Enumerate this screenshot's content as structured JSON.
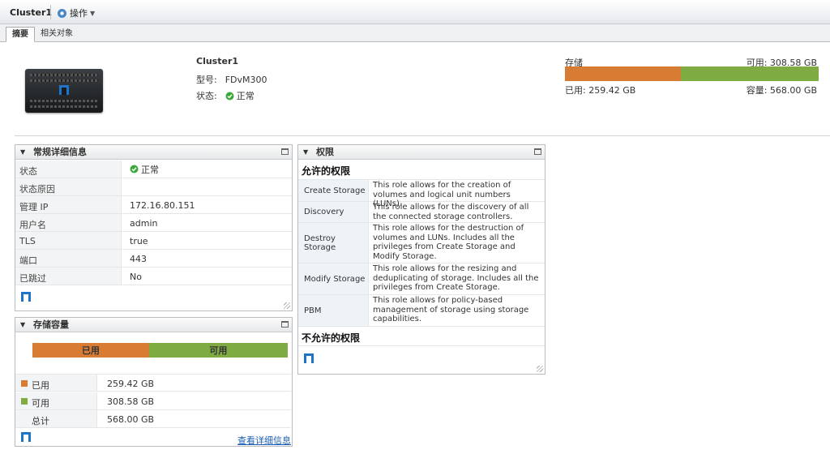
{
  "header": {
    "title": "Cluster1",
    "actions_label": "操作"
  },
  "tabs": [
    {
      "label": "摘要"
    },
    {
      "label": "相关对象"
    }
  ],
  "summary": {
    "name": "Cluster1",
    "model_label": "型号:",
    "model_value": "FDvM300",
    "status_label": "状态:",
    "status_value": "正常"
  },
  "storage": {
    "title": "存储",
    "free_text": "可用: 308.58 GB",
    "used_text": "已用: 259.42 GB",
    "capacity_text": "容量: 568.00 GB",
    "used_gb": 259.42,
    "free_gb": 308.58,
    "capacity_gb": 568.0,
    "used_color": "#d97c33",
    "free_color": "#7fac42"
  },
  "general": {
    "title": "常规详细信息",
    "rows": [
      {
        "key": "状态",
        "value": "正常"
      },
      {
        "key": "状态原因",
        "value": ""
      },
      {
        "key": "管理 IP",
        "value": "172.16.80.151"
      },
      {
        "key": "用户名",
        "value": "admin"
      },
      {
        "key": "TLS",
        "value": "true"
      },
      {
        "key": "端口",
        "value": "443"
      },
      {
        "key": "已跳过",
        "value": "No"
      }
    ]
  },
  "capacity": {
    "title": "存储容量",
    "bar_used_label": "已用",
    "bar_free_label": "可用",
    "rows": [
      {
        "key": "已用",
        "value": "259.42 GB"
      },
      {
        "key": "可用",
        "value": "308.58 GB"
      },
      {
        "key": "总计",
        "value": "568.00 GB"
      }
    ],
    "details_link": "查看详细信息"
  },
  "permissions": {
    "title": "权限",
    "allowed_heading": "允许的权限",
    "denied_heading": "不允许的权限",
    "items": [
      {
        "name": "Create Storage",
        "desc": "This role allows for the creation of volumes and logical unit numbers (LUNs)."
      },
      {
        "name": "Discovery",
        "desc": "This role allows for the discovery of all the connected storage controllers."
      },
      {
        "name": "Destroy Storage",
        "desc": "This role allows for the destruction of volumes and LUNs. Includes all the privileges from Create Storage and Modify Storage."
      },
      {
        "name": "Modify Storage",
        "desc": "This role allows for the resizing and deduplicating of storage.  Includes all the privileges from Create Storage."
      },
      {
        "name": "PBM",
        "desc": "This role allows for policy-based management of storage using storage capabilities."
      }
    ]
  },
  "icons": {
    "actions": "gear-icon",
    "status": "check-circle-icon",
    "logo": "netapp-logo-icon",
    "collapse": "triangle-down-icon",
    "maximize": "maximize-icon"
  }
}
